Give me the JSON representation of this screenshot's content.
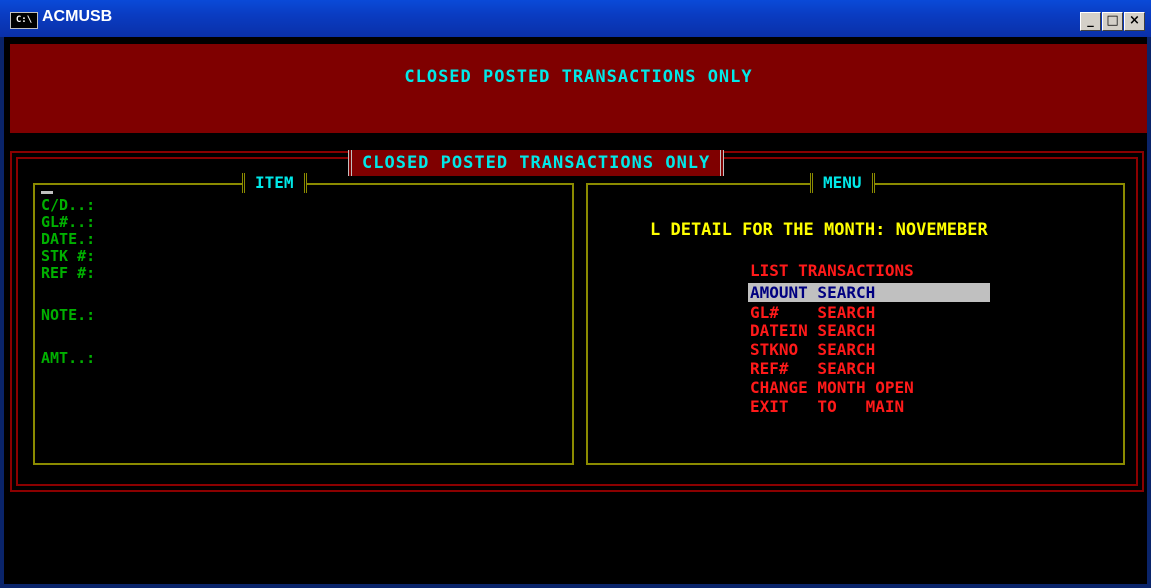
{
  "window": {
    "title": "ACMUSB",
    "icon_label": "C:\\",
    "controls": {
      "minimize": "_",
      "maximize": "□",
      "close": "×"
    }
  },
  "banner": {
    "text": "CLOSED POSTED TRANSACTIONS ONLY"
  },
  "dialog": {
    "title": "CLOSED POSTED TRANSACTIONS ONLY"
  },
  "item_panel": {
    "title": "ITEM",
    "fields": {
      "cd": "C/D..:",
      "gl": "GL#..:",
      "date": "DATE.:",
      "stk": "STK #:",
      "ref": "REF #:",
      "note": "NOTE.:",
      "amt": "AMT..:"
    }
  },
  "menu_panel": {
    "title": "MENU",
    "month_line": "L DETAIL FOR THE MONTH: NOVEMEBER",
    "items": [
      "LIST TRANSACTIONS",
      "AMOUNT SEARCH",
      "GL#    SEARCH",
      "DATEIN SEARCH",
      "STKNO  SEARCH",
      "REF#   SEARCH",
      "CHANGE MONTH OPEN",
      "EXIT   TO   MAIN"
    ],
    "selected_index": 1
  },
  "colors": {
    "console_bg": "#000000",
    "banner_bg": "#7f0000",
    "title_text": "#00e8e8",
    "field_label": "#00b000",
    "menu_text": "#ff1a1a",
    "menu_selected_bg": "#c0c0c0",
    "menu_selected_text": "#000080",
    "month_text": "#ffff00",
    "panel_border": "#8b8b00"
  }
}
